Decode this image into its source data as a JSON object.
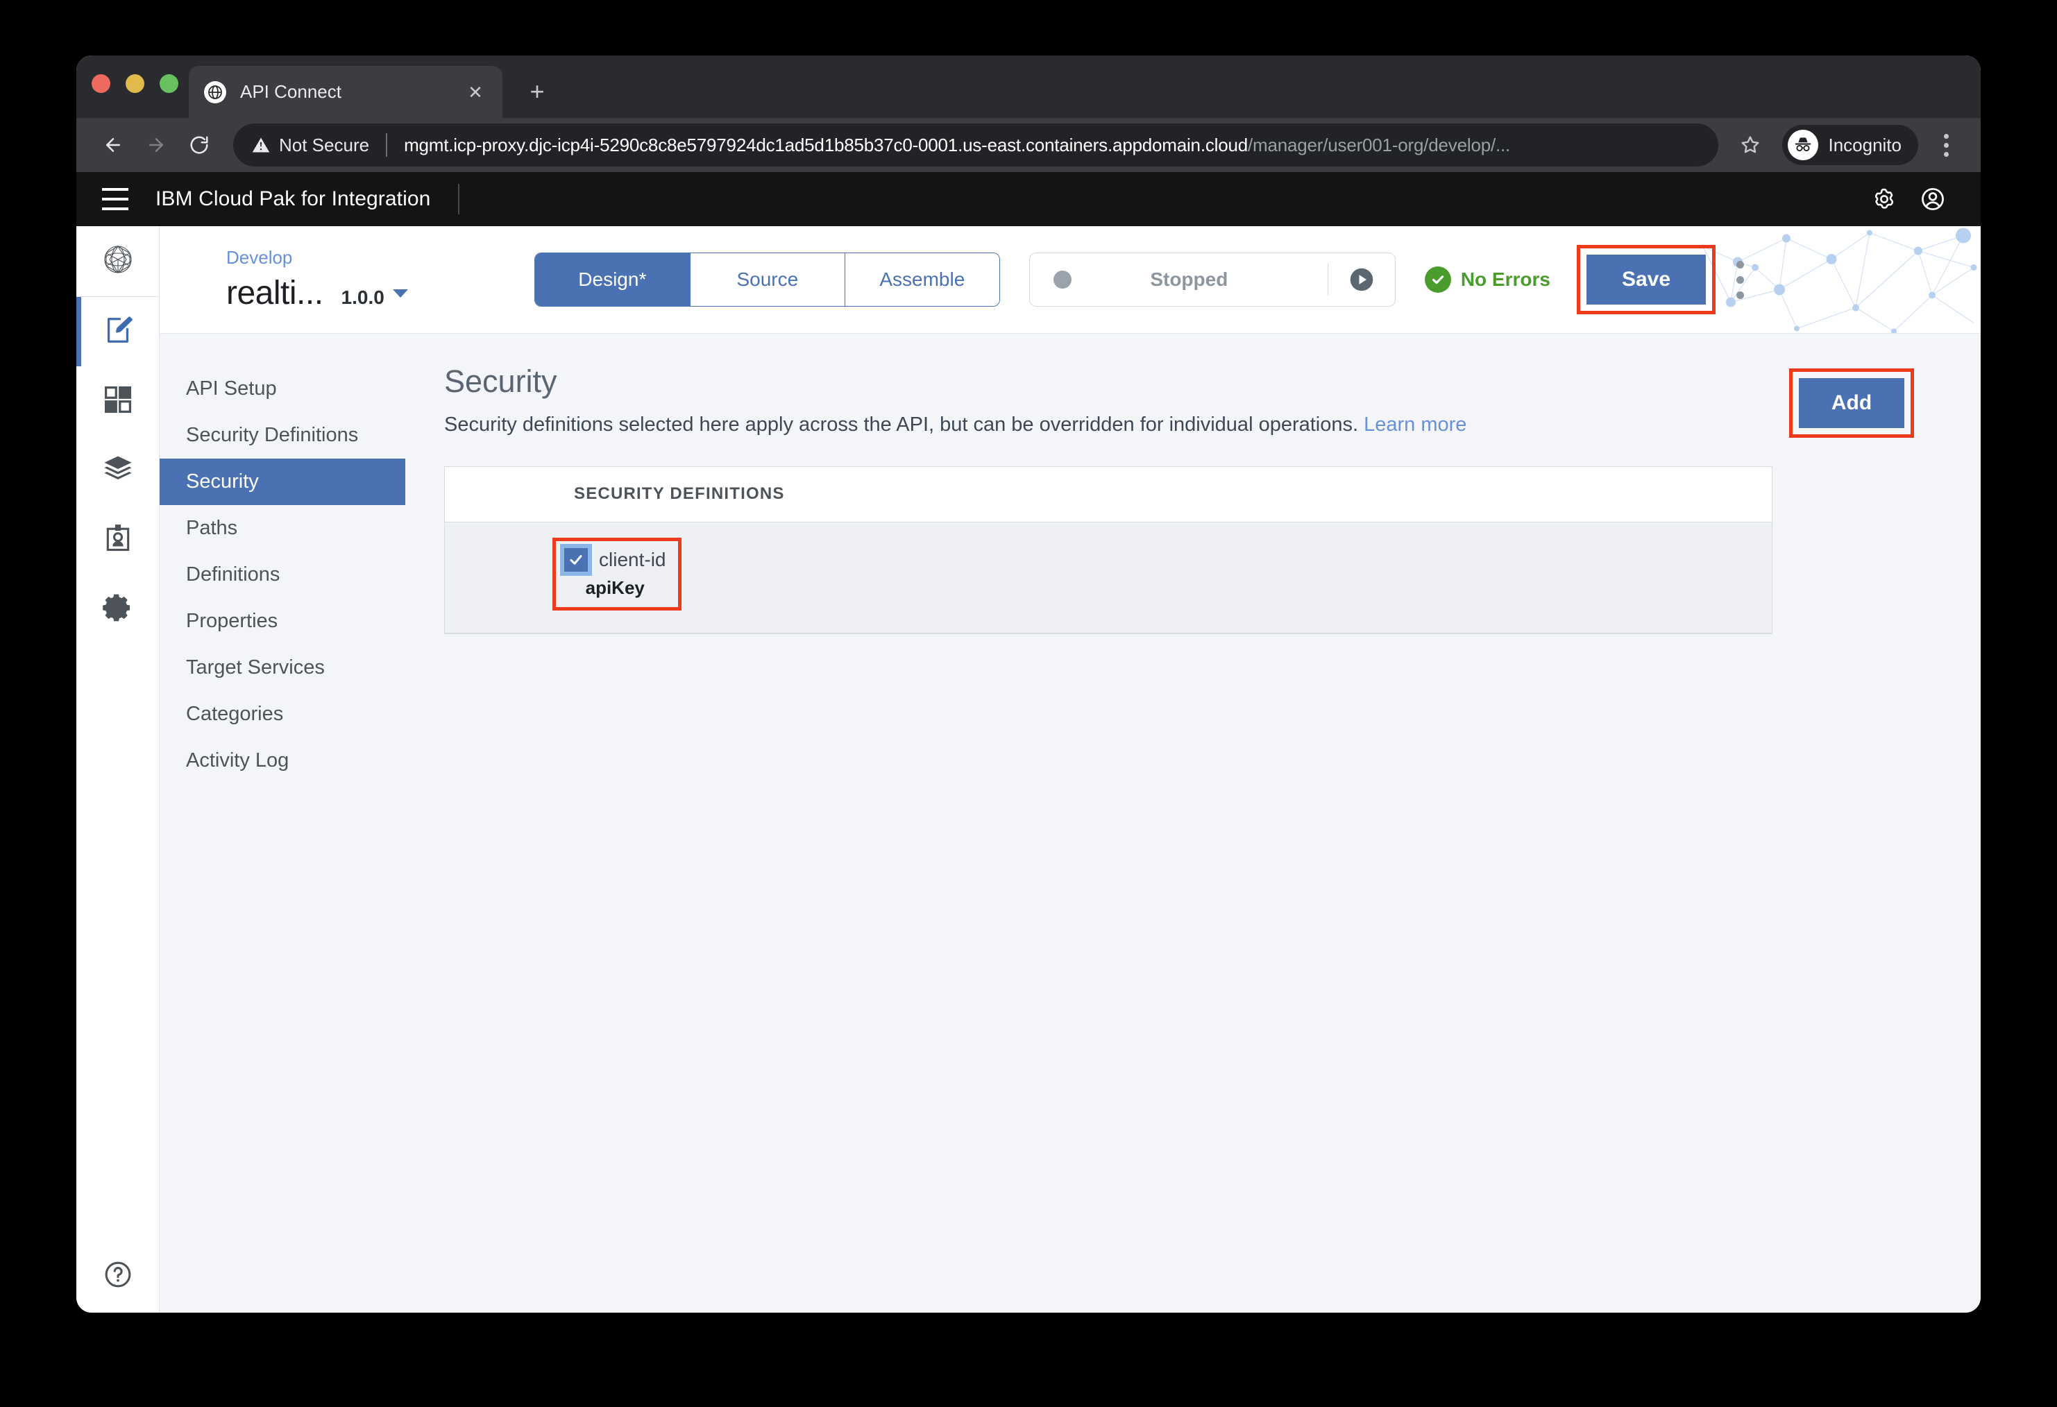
{
  "browser": {
    "tab": {
      "title": "API Connect",
      "favicon_icon": "globe-icon",
      "close_icon": "close-icon"
    },
    "new_tab_icon": "plus-icon",
    "back_icon": "back-arrow-icon",
    "forward_icon": "forward-arrow-icon",
    "reload_icon": "reload-icon",
    "security_label": "Not Secure",
    "security_icon": "warning-triangle-icon",
    "url_host": "mgmt.icp-proxy.djc-icp4i-5290c8c8e5797924dc1ad5d1b85b37c0-0001.us-east.containers.appdomain.cloud",
    "url_path": "/manager/user001-org/develop/...",
    "star_icon": "bookmark-star-icon",
    "profile_label": "Incognito",
    "profile_icon": "incognito-hat-icon",
    "menu_icon": "three-dot-menu-icon"
  },
  "app_header": {
    "menu_icon": "hamburger-menu-icon",
    "title": "IBM Cloud Pak for Integration",
    "settings_icon": "gear-icon",
    "account_icon": "user-avatar-icon"
  },
  "rail": {
    "items": [
      {
        "name": "platform-logo",
        "icon": "network-sphere-icon",
        "active": false
      },
      {
        "name": "develop",
        "icon": "edit-document-icon",
        "active": true
      },
      {
        "name": "dashboard",
        "icon": "tiles-icon",
        "active": false
      },
      {
        "name": "catalogs",
        "icon": "layers-icon",
        "active": false
      },
      {
        "name": "consumers",
        "icon": "id-badge-icon",
        "active": false
      },
      {
        "name": "settings",
        "icon": "gear-icon",
        "active": false
      }
    ],
    "help_icon": "question-circle-icon"
  },
  "api_header": {
    "breadcrumb": "Develop",
    "api_name": "realti...",
    "version": "1.0.0",
    "version_caret_icon": "chevron-down-icon",
    "tabs": [
      {
        "label": "Design*",
        "active": true
      },
      {
        "label": "Source",
        "active": false
      },
      {
        "label": "Assemble",
        "active": false
      }
    ],
    "status_label": "Stopped",
    "status_dot_color": "#9aa2ab",
    "play_icon": "play-circle-icon",
    "errors_label": "No Errors",
    "errors_icon": "check-circle-icon",
    "errors_color": "#4a9c2d",
    "save_label": "Save",
    "kebab_icon": "three-dot-menu-icon",
    "accent_color": "#4a72b2",
    "highlight_color": "#ec3a1b"
  },
  "subnav": {
    "items": [
      {
        "label": "API Setup",
        "active": false
      },
      {
        "label": "Security Definitions",
        "active": false
      },
      {
        "label": "Security",
        "active": true
      },
      {
        "label": "Paths",
        "active": false
      },
      {
        "label": "Definitions",
        "active": false
      },
      {
        "label": "Properties",
        "active": false
      },
      {
        "label": "Target Services",
        "active": false
      },
      {
        "label": "Categories",
        "active": false
      },
      {
        "label": "Activity Log",
        "active": false
      }
    ]
  },
  "content": {
    "heading": "Security",
    "description": "Security definitions selected here apply across the API, but can be overridden for individual operations.",
    "learn_more": "Learn more",
    "add_label": "Add",
    "table": {
      "column_header": "SECURITY DEFINITIONS",
      "rows": [
        {
          "checked": true,
          "name": "client-id",
          "type": "apiKey",
          "check_icon": "checkmark-icon"
        }
      ]
    }
  }
}
